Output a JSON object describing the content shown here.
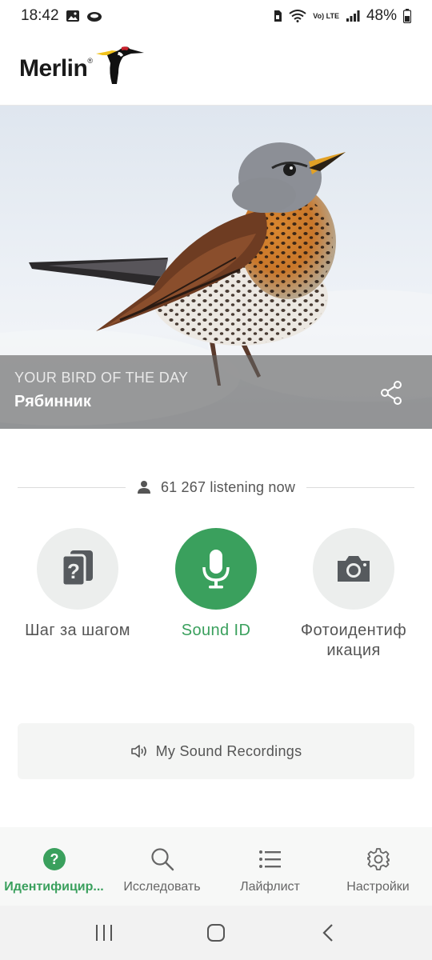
{
  "status_bar": {
    "time": "18:42",
    "battery": "48%",
    "network": "Vo) LTE"
  },
  "header": {
    "logo_text": "Merlin",
    "logo_mark": "®"
  },
  "hero": {
    "kicker": "YOUR BIRD OF THE DAY",
    "bird_name": "Рябинник",
    "share_icon": "share-icon"
  },
  "listeners": {
    "text": "61 267 listening now",
    "icon": "person-icon"
  },
  "options": [
    {
      "label": "Шаг за шагом",
      "icon": "cards-question-icon"
    },
    {
      "label": "Sound ID",
      "icon": "microphone-icon"
    },
    {
      "label": "Фотоидентиф икация",
      "icon": "camera-icon"
    }
  ],
  "recordings": {
    "label": "My Sound Recordings",
    "icon": "speaker-icon"
  },
  "bottom_nav": [
    {
      "label": "Идентифицир...",
      "icon": "help-circle-icon",
      "active": true
    },
    {
      "label": "Исследовать",
      "icon": "search-icon",
      "active": false
    },
    {
      "label": "Лайфлист",
      "icon": "list-icon",
      "active": false
    },
    {
      "label": "Настройки",
      "icon": "gear-icon",
      "active": false
    }
  ],
  "colors": {
    "accent_green": "#3aa05d",
    "nav_background": "#f7f8f7",
    "overlay": "rgba(95,95,95,0.62)"
  }
}
